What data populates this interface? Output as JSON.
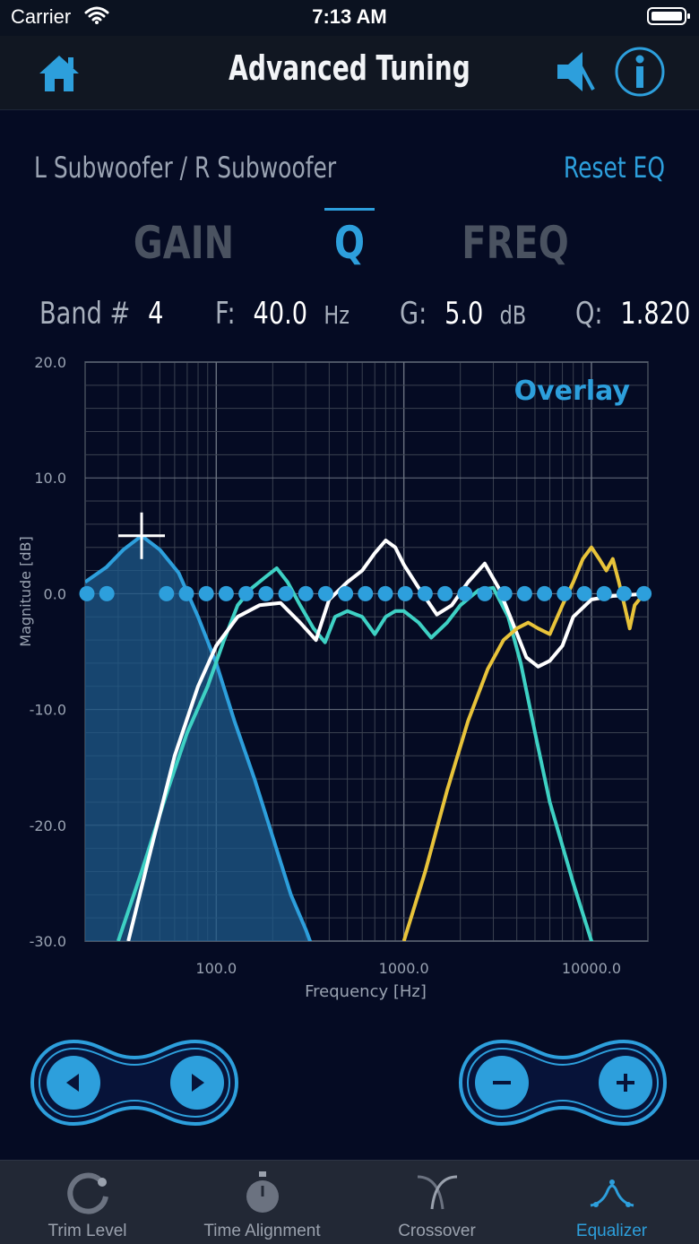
{
  "status_bar": {
    "carrier": "Carrier",
    "time": "7:13 AM"
  },
  "nav": {
    "title": "Advanced Tuning",
    "home_icon": "home-icon",
    "speaker_icon": "speaker-icon",
    "info_icon": "info-icon"
  },
  "channel_label": "L Subwoofer / R Subwoofer",
  "reset_label": "Reset EQ",
  "tabs": [
    {
      "label": "GAIN",
      "active": false
    },
    {
      "label": "Q",
      "active": true
    },
    {
      "label": "FREQ",
      "active": false
    }
  ],
  "params": {
    "band_label": "Band #",
    "band_value": "4",
    "freq_label": "F:",
    "freq_value": "40.0",
    "freq_unit": "Hz",
    "gain_label": "G:",
    "gain_value": "5.0",
    "gain_unit": "dB",
    "q_label": "Q:",
    "q_value": "1.820"
  },
  "chart_data": {
    "type": "line",
    "overlay_label": "Overlay",
    "xlabel": "Frequency [Hz]",
    "ylabel": "Magnitude [dB]",
    "xscale": "log",
    "xlim": [
      20,
      20000
    ],
    "ylim": [
      -30,
      20
    ],
    "y_ticks": [
      "20.0",
      "10.0",
      "0.0",
      "-10.0",
      "-20.0",
      "-30.0"
    ],
    "x_ticks": [
      "100.0",
      "1000.0",
      "10000.0"
    ],
    "grid": true,
    "series": [
      {
        "color": "#2d9fdc",
        "fill": true,
        "x": [
          20,
          26,
          32,
          40,
          50,
          63,
          80,
          100,
          125,
          160,
          200,
          250,
          300,
          370
        ],
        "y": [
          1,
          2.3,
          3.8,
          5,
          3.8,
          1.8,
          -2,
          -6,
          -11,
          -16,
          -21,
          -26,
          -29,
          -33
        ]
      },
      {
        "color": "#3ed1c4",
        "x": [
          30,
          40,
          55,
          70,
          90,
          110,
          130,
          155,
          185,
          210,
          240,
          280,
          330,
          380,
          430,
          500,
          600,
          700,
          800,
          900,
          1000,
          1200,
          1400,
          1700,
          2000,
          2500,
          3000,
          3600,
          4200,
          5000,
          6000,
          8000,
          10000,
          12000
        ],
        "y": [
          -30,
          -24,
          -17,
          -12,
          -8,
          -4,
          -1,
          0.5,
          1.5,
          2.2,
          1,
          -1,
          -3,
          -4.2,
          -2,
          -1.5,
          -2,
          -3.5,
          -2,
          -1.5,
          -1.5,
          -2.5,
          -3.8,
          -2.5,
          -1,
          0.3,
          0.5,
          -2,
          -6,
          -12,
          -18,
          -25,
          -30,
          -33
        ]
      },
      {
        "color": "#ffffff",
        "x": [
          34,
          45,
          60,
          80,
          100,
          130,
          170,
          220,
          280,
          340,
          400,
          500,
          600,
          700,
          800,
          900,
          1000,
          1200,
          1500,
          1800,
          2200,
          2700,
          3200,
          3800,
          4500,
          5200,
          6000,
          7000,
          8000,
          10000,
          13000,
          20000
        ],
        "y": [
          -30,
          -22,
          -14,
          -8,
          -4.5,
          -2,
          -1,
          -0.8,
          -2.5,
          -4,
          -0.5,
          1,
          2,
          3.5,
          4.6,
          4,
          2.5,
          0.5,
          -1.8,
          -1,
          1,
          2.6,
          0.5,
          -2.5,
          -5.5,
          -6.3,
          -5.8,
          -4.5,
          -2,
          -0.5,
          -0.2,
          0
        ]
      },
      {
        "color": "#e8c33a",
        "x": [
          1000,
          1300,
          1700,
          2200,
          2800,
          3400,
          4000,
          4600,
          5200,
          6000,
          7000,
          8000,
          9000,
          10000,
          11000,
          12000,
          13000,
          14000,
          15000,
          16000,
          17000,
          18000,
          20000
        ],
        "y": [
          -30,
          -24,
          -17,
          -11,
          -6.5,
          -4,
          -3,
          -2.5,
          -3,
          -3.5,
          -1,
          1,
          3,
          4,
          3,
          2,
          3,
          1,
          -1,
          -3,
          -1,
          -0.5,
          0
        ]
      },
      {
        "color": "#2d9fdc",
        "style": "dots",
        "x_px_from": "0dB line",
        "y": [
          0
        ]
      }
    ],
    "marker": {
      "freq": 40,
      "gain": 5.0
    }
  },
  "controls": {
    "prev_icon": "triangle-left-icon",
    "next_icon": "triangle-right-icon",
    "minus_icon": "minus-icon",
    "plus_icon": "plus-icon"
  },
  "tabbar": {
    "items": [
      {
        "label": "Trim Level",
        "icon": "trim-knob-icon",
        "active": false
      },
      {
        "label": "Time Alignment",
        "icon": "stopwatch-icon",
        "active": false
      },
      {
        "label": "Crossover",
        "icon": "crossover-icon",
        "active": false
      },
      {
        "label": "Equalizer",
        "icon": "equalizer-icon",
        "active": true
      }
    ]
  },
  "colors": {
    "accent": "#2d9fdc",
    "background": "#050b23",
    "nav": "#111722"
  }
}
